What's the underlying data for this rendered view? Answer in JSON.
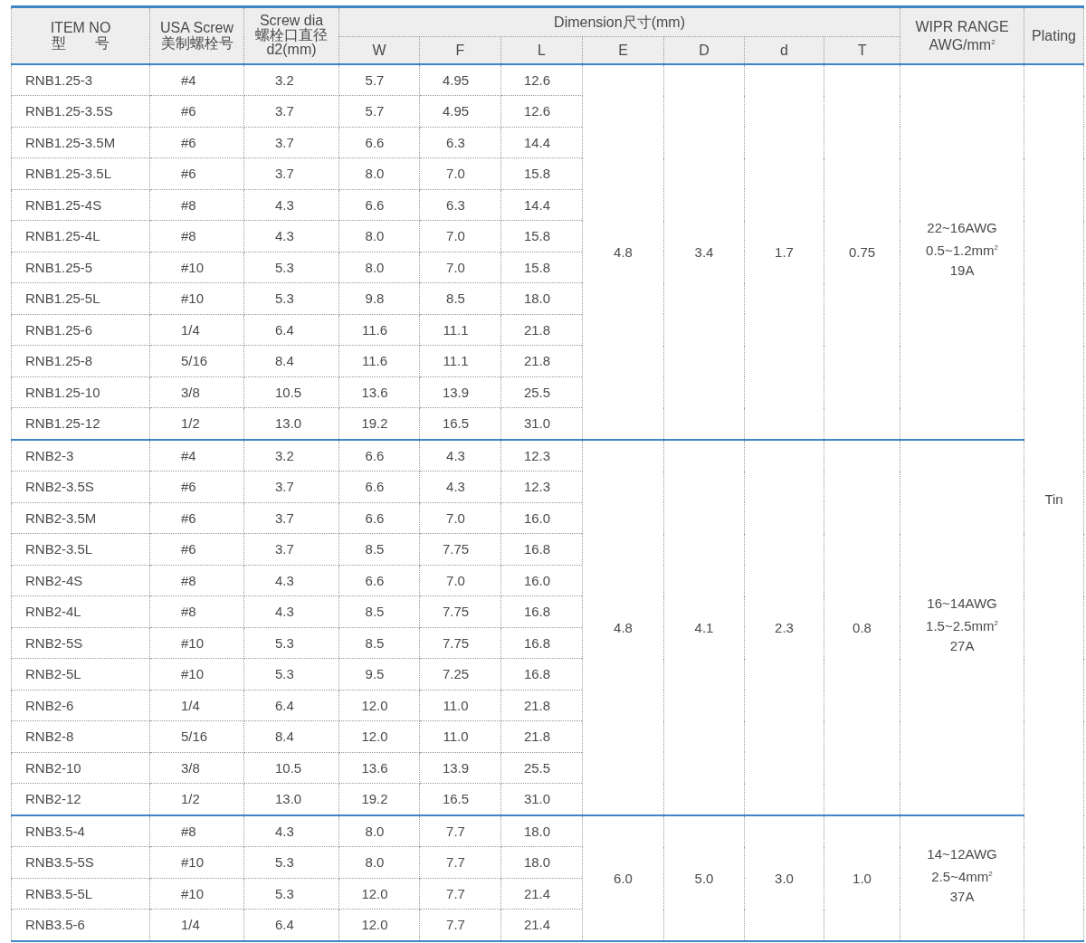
{
  "table": {
    "header": {
      "item": [
        "ITEM NO",
        "型　　号"
      ],
      "screw": [
        "USA Screw",
        "美制螺栓号"
      ],
      "d2": [
        "Screw dia",
        "螺栓口直径",
        "d2(mm)"
      ],
      "dimension": "Dimension尺寸(mm)",
      "dims": [
        "W",
        "F",
        "L",
        "E",
        "D",
        "d",
        "T"
      ],
      "range": [
        "WIPR RANGE",
        "AWG/mm$^{2}$"
      ],
      "plating": "Plating"
    },
    "plating": "Tin",
    "groups": [
      {
        "E": "4.8",
        "D": "3.4",
        "d": "1.7",
        "T": "0.75",
        "range": [
          "22~16AWG",
          "0.5~1.2mm$^{2}$",
          "19A"
        ],
        "rows": [
          [
            "RNB1.25-3",
            "#4",
            "3.2",
            "5.7",
            "4.95",
            "12.6"
          ],
          [
            "RNB1.25-3.5S",
            "#6",
            "3.7",
            "5.7",
            "4.95",
            "12.6"
          ],
          [
            "RNB1.25-3.5M",
            "#6",
            "3.7",
            "6.6",
            "6.3",
            "14.4"
          ],
          [
            "RNB1.25-3.5L",
            "#6",
            "3.7",
            "8.0",
            "7.0",
            "15.8"
          ],
          [
            "RNB1.25-4S",
            "#8",
            "4.3",
            "6.6",
            "6.3",
            "14.4"
          ],
          [
            "RNB1.25-4L",
            "#8",
            "4.3",
            "8.0",
            "7.0",
            "15.8"
          ],
          [
            "RNB1.25-5",
            "#10",
            "5.3",
            "8.0",
            "7.0",
            "15.8"
          ],
          [
            "RNB1.25-5L",
            "#10",
            "5.3",
            "9.8",
            "8.5",
            "18.0"
          ],
          [
            "RNB1.25-6",
            "1/4",
            "6.4",
            "11.6",
            "11.1",
            "21.8"
          ],
          [
            "RNB1.25-8",
            "5/16",
            "8.4",
            "11.6",
            "11.1",
            "21.8"
          ],
          [
            "RNB1.25-10",
            "3/8",
            "10.5",
            "13.6",
            "13.9",
            "25.5"
          ],
          [
            "RNB1.25-12",
            "1/2",
            "13.0",
            "19.2",
            "16.5",
            "31.0"
          ]
        ]
      },
      {
        "E": "4.8",
        "D": "4.1",
        "d": "2.3",
        "T": "0.8",
        "range": [
          "16~14AWG",
          "1.5~2.5mm$^{2}$",
          "27A"
        ],
        "rows": [
          [
            "RNB2-3",
            "#4",
            "3.2",
            "6.6",
            "4.3",
            "12.3"
          ],
          [
            "RNB2-3.5S",
            "#6",
            "3.7",
            "6.6",
            "4.3",
            "12.3"
          ],
          [
            "RNB2-3.5M",
            "#6",
            "3.7",
            "6.6",
            "7.0",
            "16.0"
          ],
          [
            "RNB2-3.5L",
            "#6",
            "3.7",
            "8.5",
            "7.75",
            "16.8"
          ],
          [
            "RNB2-4S",
            "#8",
            "4.3",
            "6.6",
            "7.0",
            "16.0"
          ],
          [
            "RNB2-4L",
            "#8",
            "4.3",
            "8.5",
            "7.75",
            "16.8"
          ],
          [
            "RNB2-5S",
            "#10",
            "5.3",
            "8.5",
            "7.75",
            "16.8"
          ],
          [
            "RNB2-5L",
            "#10",
            "5.3",
            "9.5",
            "7.25",
            "16.8"
          ],
          [
            "RNB2-6",
            "1/4",
            "6.4",
            "12.0",
            "11.0",
            "21.8"
          ],
          [
            "RNB2-8",
            "5/16",
            "8.4",
            "12.0",
            "11.0",
            "21.8"
          ],
          [
            "RNB2-10",
            "3/8",
            "10.5",
            "13.6",
            "13.9",
            "25.5"
          ],
          [
            "RNB2-12",
            "1/2",
            "13.0",
            "19.2",
            "16.5",
            "31.0"
          ]
        ]
      },
      {
        "E": "6.0",
        "D": "5.0",
        "d": "3.0",
        "T": "1.0",
        "range": [
          "14~12AWG",
          "2.5~4mm$^{2}$",
          "37A"
        ],
        "rows": [
          [
            "RNB3.5-4",
            "#8",
            "4.3",
            "8.0",
            "7.7",
            "18.0"
          ],
          [
            "RNB3.5-5S",
            "#10",
            "5.3",
            "8.0",
            "7.7",
            "18.0"
          ],
          [
            "RNB3.5-5L",
            "#10",
            "5.3",
            "12.0",
            "7.7",
            "21.4"
          ],
          [
            "RNB3.5-6",
            "1/4",
            "6.4",
            "12.0",
            "7.7",
            "21.4"
          ]
        ]
      }
    ]
  }
}
